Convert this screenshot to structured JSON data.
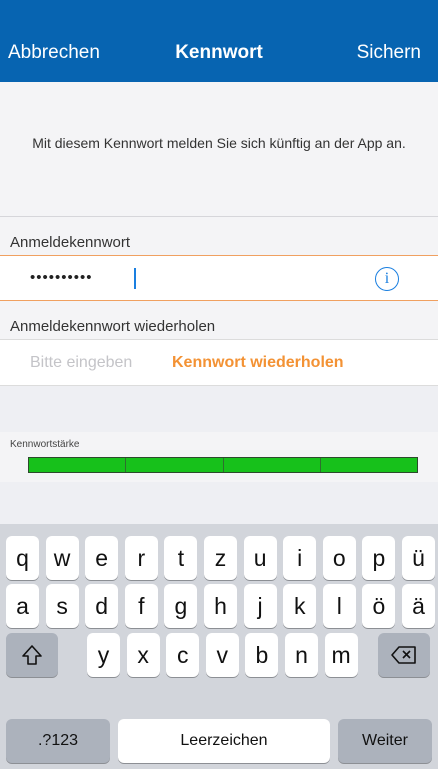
{
  "navbar": {
    "cancel": "Abbrechen",
    "title": "Kennwort",
    "save": "Sichern"
  },
  "info": {
    "text": "Mit diesem Kennwort melden Sie sich künftig an der App an."
  },
  "password": {
    "label": "Anmeldekennwort",
    "masked_value": "••••••••••",
    "info_icon": "info-circle-icon"
  },
  "repeat": {
    "label": "Anmeldekennwort wiederholen",
    "placeholder": "Bitte eingeben",
    "hint": "Kennwort wiederholen"
  },
  "strength": {
    "label": "Kennwortstärke",
    "segments_total": 4,
    "segments_filled": 4,
    "color": "#17c11b"
  },
  "keyboard": {
    "row1": [
      "q",
      "w",
      "e",
      "r",
      "t",
      "z",
      "u",
      "i",
      "o",
      "p",
      "ü"
    ],
    "row2": [
      "a",
      "s",
      "d",
      "f",
      "g",
      "h",
      "j",
      "k",
      "l",
      "ö",
      "ä"
    ],
    "row3": [
      "y",
      "x",
      "c",
      "v",
      "b",
      "n",
      "m"
    ],
    "shift_icon": "shift-arrow-icon",
    "backspace_icon": "backspace-icon",
    "numbers": ".?123",
    "space": "Leerzeichen",
    "return": "Weiter"
  }
}
